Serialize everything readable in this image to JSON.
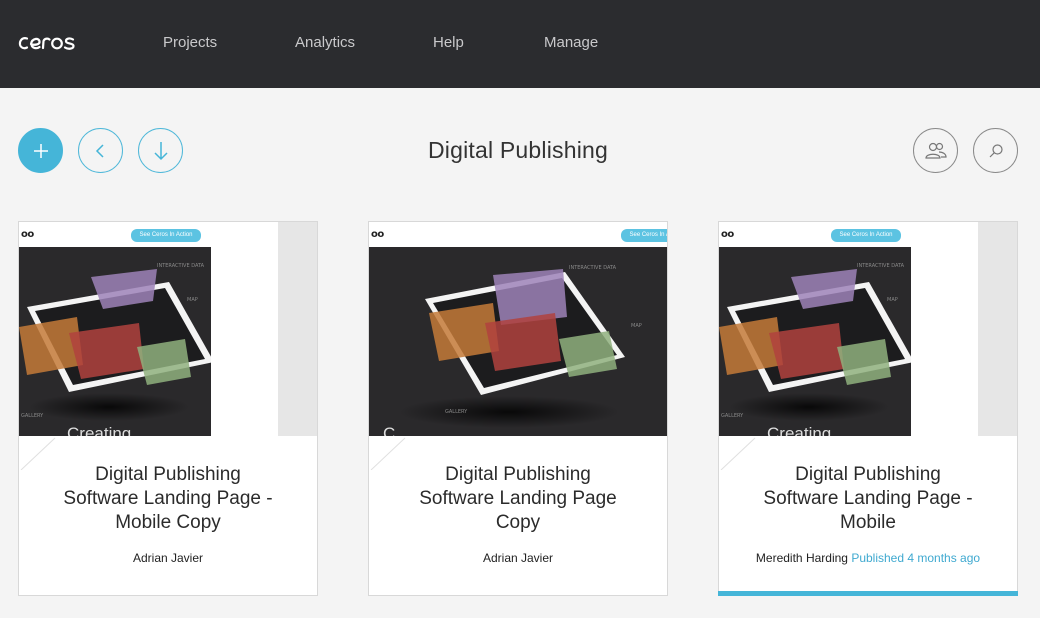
{
  "app": {
    "logo_text": "ceros",
    "accent": "#45b5d8"
  },
  "nav": [
    {
      "label": "Projects"
    },
    {
      "label": "Analytics"
    },
    {
      "label": "Help"
    },
    {
      "label": "Manage"
    }
  ],
  "toolbar": {
    "add_icon": "plus-icon",
    "back_icon": "chevron-left-icon",
    "download_icon": "arrow-down-icon",
    "users_icon": "users-icon",
    "search_icon": "search-icon"
  },
  "page": {
    "title": "Digital Publishing"
  },
  "cards": [
    {
      "title_lines": [
        "Digital Publishing",
        "Software Landing Page -",
        "Mobile Copy"
      ],
      "author": "Adrian Javier",
      "status": "",
      "thumb": {
        "cta": "See Ceros In Action",
        "overlay_text": "Creating",
        "labels": [
          "INTERACTIVE DATA",
          "MAP",
          "GALLERY"
        ]
      },
      "active": false
    },
    {
      "title_lines": [
        "Digital Publishing",
        "Software Landing Page",
        "Copy"
      ],
      "author": "Adrian Javier",
      "status": "",
      "thumb": {
        "cta": "See Ceros In Action",
        "overlay_text": "C",
        "labels": [
          "INTERACTIVE DATA",
          "MAP",
          "GALLERY"
        ]
      },
      "active": false
    },
    {
      "title_lines": [
        "Digital Publishing",
        "Software Landing Page -",
        "Mobile"
      ],
      "author": "Meredith Harding",
      "status": "Published 4 months ago",
      "thumb": {
        "cta": "See Ceros In Action",
        "overlay_text": "Creating",
        "labels": [
          "INTERACTIVE DATA",
          "MAP",
          "GALLERY"
        ]
      },
      "active": true
    }
  ]
}
